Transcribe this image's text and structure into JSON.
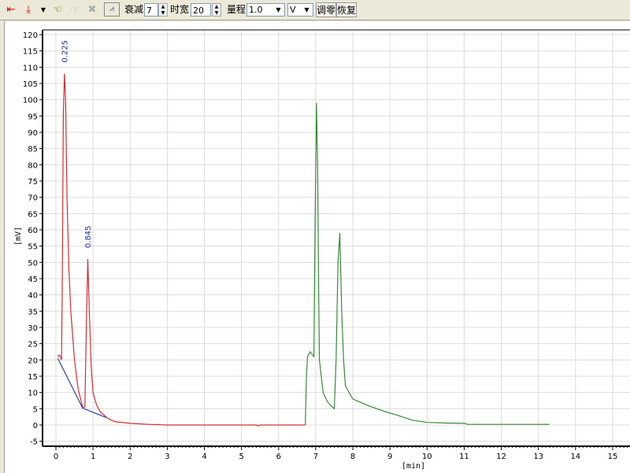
{
  "toolbar": {
    "icons": [
      "start-arrow-icon",
      "marker-down-icon",
      "dropdown-icon",
      "hand-pointer-icon",
      "hand-pointer-disabled-icon",
      "delete-icon",
      "chart-icon"
    ],
    "attenuation_label": "衰减",
    "attenuation_value": "7",
    "timewidth_label": "时宽",
    "timewidth_value": "20",
    "range_label": "量程",
    "range_value": "1.0",
    "unit_value": "V",
    "zero_button": "调零",
    "restore_button": "恢复"
  },
  "chart_data": {
    "type": "line",
    "xlabel": "[min]",
    "ylabel": "[mV]",
    "xlim": [
      -0.35,
      15.5
    ],
    "ylim": [
      -6.5,
      122.5
    ],
    "xticks": [
      0,
      1,
      2,
      3,
      4,
      5,
      6,
      7,
      8,
      9,
      10,
      11,
      12,
      13,
      14,
      15
    ],
    "yticks": [
      -5,
      0,
      5,
      10,
      15,
      20,
      25,
      30,
      35,
      40,
      45,
      50,
      55,
      60,
      65,
      70,
      75,
      80,
      85,
      90,
      95,
      100,
      105,
      110,
      115,
      120
    ],
    "grid": true,
    "series": [
      {
        "name": "red-trace",
        "color": "#d03030",
        "x": [
          0.05,
          0.1,
          0.15,
          0.17,
          0.2,
          0.23,
          0.26,
          0.3,
          0.35,
          0.4,
          0.5,
          0.6,
          0.72,
          0.78,
          0.82,
          0.86,
          0.9,
          0.95,
          1.0,
          1.1,
          1.2,
          1.4,
          1.6,
          2.0,
          2.5,
          3,
          5.4,
          5.45,
          5.5,
          6.72
        ],
        "y": [
          21,
          21.5,
          20,
          40,
          95,
          108,
          100,
          70,
          48,
          35,
          20,
          11,
          5.5,
          5.5,
          30,
          51,
          35,
          18,
          10,
          6,
          4,
          2,
          1,
          0.5,
          0.2,
          0,
          0,
          -0.3,
          0,
          0
        ]
      },
      {
        "name": "baseline",
        "color": "#3040b0",
        "x": [
          0.05,
          0.72,
          1.35
        ],
        "y": [
          20.5,
          5.2,
          2.3
        ]
      },
      {
        "name": "green-trace",
        "color": "#3a8a3a",
        "x": [
          6.72,
          6.75,
          6.78,
          6.85,
          6.95,
          6.98,
          7.02,
          7.05,
          7.08,
          7.1,
          7.2,
          7.3,
          7.4,
          7.5,
          7.55,
          7.6,
          7.65,
          7.7,
          7.75,
          7.8,
          8.0,
          8.4,
          8.9,
          9.2,
          9.6,
          10.0,
          10.5,
          11.0,
          11.1,
          13.3
        ],
        "y": [
          0,
          15,
          21,
          22.5,
          21,
          60,
          99,
          80,
          40,
          20,
          10,
          7.5,
          6,
          5,
          20,
          50,
          59,
          35,
          20,
          12,
          8,
          6,
          4,
          3,
          1.5,
          0.8,
          0.6,
          0.5,
          0.2,
          0.2
        ]
      }
    ],
    "annotations": [
      {
        "x": 0.225,
        "y": 108,
        "text": "0.225"
      },
      {
        "x": 0.845,
        "y": 51,
        "text": "0.845"
      }
    ]
  }
}
